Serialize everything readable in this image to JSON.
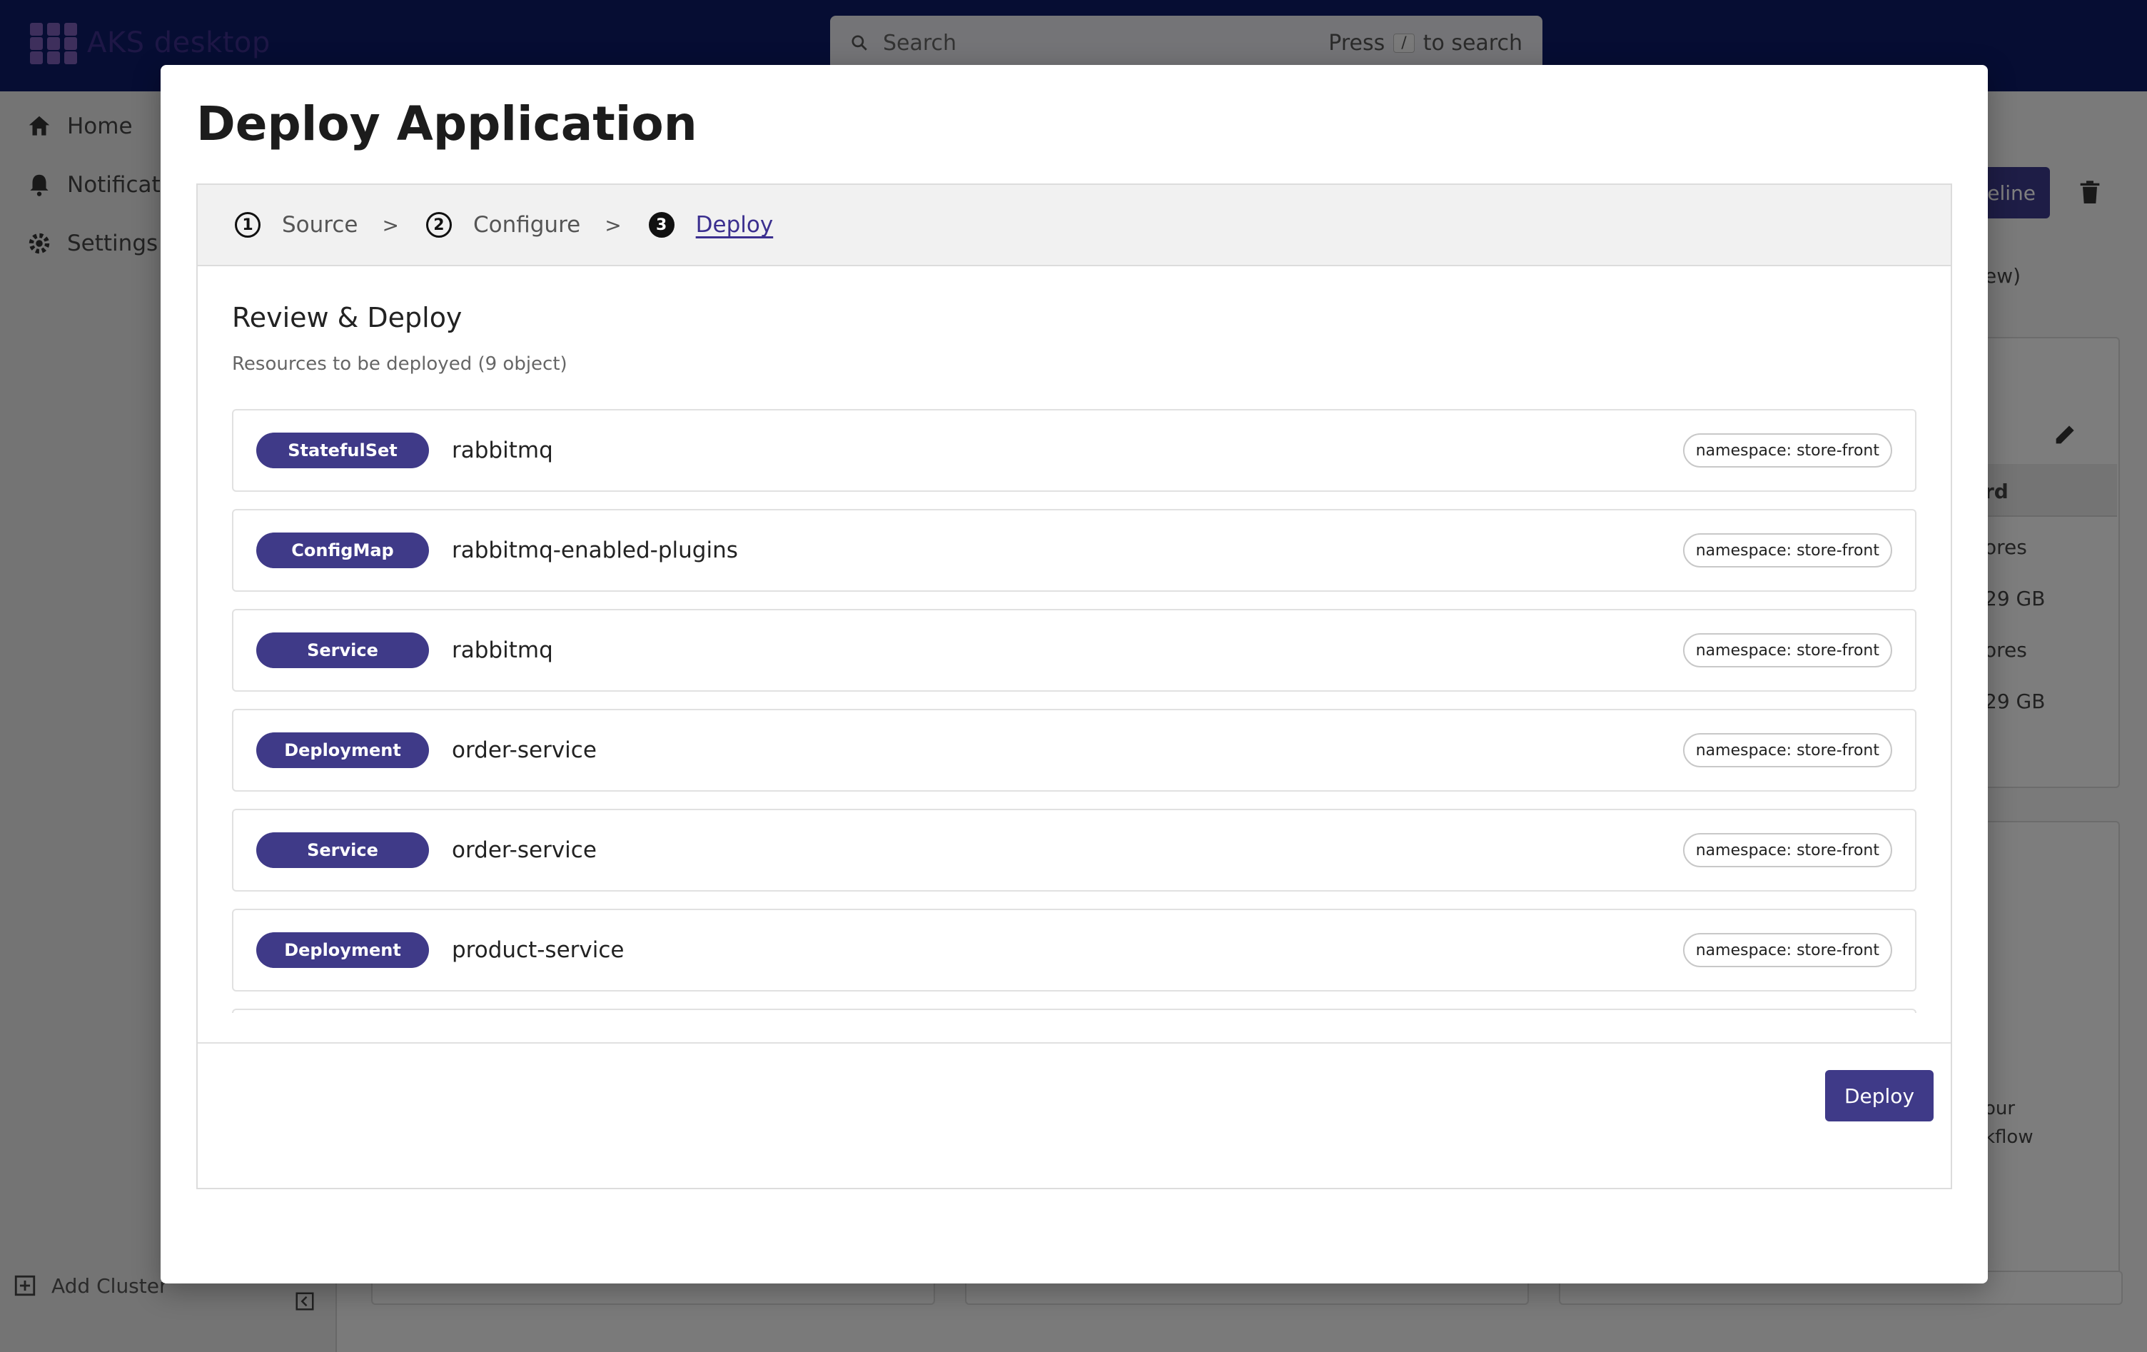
{
  "app": {
    "title": "AKS desktop",
    "search_placeholder": "Search",
    "search_hint_press": "Press",
    "search_hint_key": "/",
    "search_hint_rest": "to search"
  },
  "sidebar": {
    "items": [
      {
        "label": "Home",
        "icon": "home-icon"
      },
      {
        "label": "Notificati",
        "icon": "bell-icon"
      },
      {
        "label": "Settings",
        "icon": "gear-icon"
      }
    ],
    "add_cluster": "Add Cluster"
  },
  "background": {
    "pipeline_button": "eline",
    "text_view": "ew)",
    "table_header": "rd",
    "cells": [
      "ores",
      "29 GB",
      "ores",
      "29 GB"
    ],
    "text_your": "our",
    "text_workflow": "kflow"
  },
  "modal": {
    "title": "Deploy Application",
    "steps": [
      {
        "num": "1",
        "label": "Source"
      },
      {
        "num": "2",
        "label": "Configure"
      },
      {
        "num": "3",
        "label": "Deploy"
      }
    ],
    "step_separator": ">",
    "review_title": "Review & Deploy",
    "review_subtitle": "Resources to be deployed (9 object)",
    "resources": [
      {
        "kind": "StatefulSet",
        "name": "rabbitmq",
        "namespace": "namespace: store-front"
      },
      {
        "kind": "ConfigMap",
        "name": "rabbitmq-enabled-plugins",
        "namespace": "namespace: store-front"
      },
      {
        "kind": "Service",
        "name": "rabbitmq",
        "namespace": "namespace: store-front"
      },
      {
        "kind": "Deployment",
        "name": "order-service",
        "namespace": "namespace: store-front"
      },
      {
        "kind": "Service",
        "name": "order-service",
        "namespace": "namespace: store-front"
      },
      {
        "kind": "Deployment",
        "name": "product-service",
        "namespace": "namespace: store-front"
      }
    ],
    "deploy_button": "Deploy"
  },
  "colors": {
    "topbar": "#0d1a66",
    "accent": "#3f3a88"
  }
}
